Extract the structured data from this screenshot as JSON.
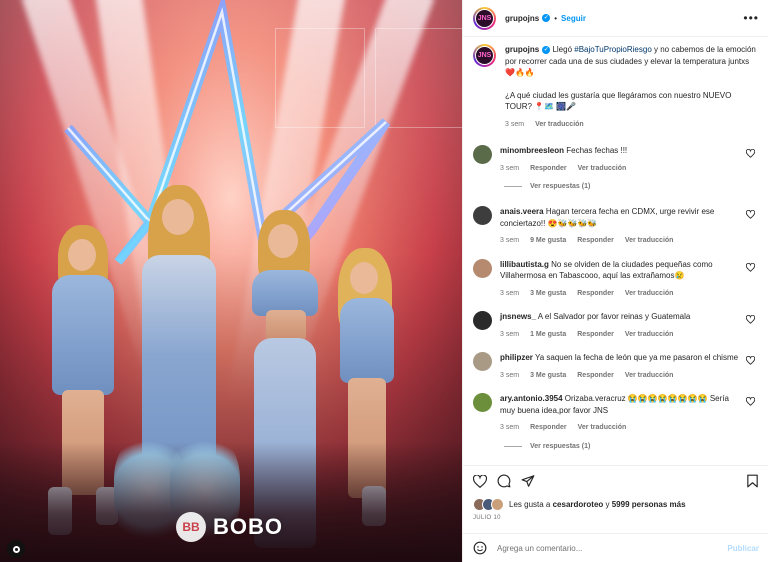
{
  "post": {
    "username": "grupojns",
    "follow_label": "Seguir",
    "separator": "•",
    "more_label": "•••",
    "avatar_text": "JNS"
  },
  "photo": {
    "watermark_text": "BOBO",
    "watermark_logo": "BB"
  },
  "caption": {
    "username": "grupojns",
    "text_before": " Llegó ",
    "hashtag": "#BajoTuPropioRiesgo",
    "text_after": " y no cabemos de la emoción por recorrer cada una de sus ciudades y elevar la temperatura juntxs❤️🔥🔥",
    "question": "¿A qué ciudad les gustaría que llegáramos con nuestro NUEVO TOUR? 📍🗺️ 🎆🎤",
    "time": "3 sem",
    "translation": "Ver traducción"
  },
  "comments": [
    {
      "username": "minombreesleon",
      "text": " Fechas fechas !!!",
      "time": "3 sem",
      "likes": "",
      "reply": "Responder",
      "translation": "Ver traducción",
      "replies": "Ver respuestas (1)",
      "avatar_color": "#5a6b4a"
    },
    {
      "username": "anais.veera",
      "text": " Hagan tercera fecha en CDMX, urge revivir ese conciertazo!! 😍🐝🐝🐝🐝",
      "time": "3 sem",
      "likes": "9 Me gusta",
      "reply": "Responder",
      "translation": "Ver traducción",
      "replies": "",
      "avatar_color": "#3d3d3d"
    },
    {
      "username": "lillibautista.g",
      "text": " No se olviden de la ciudades pequeñas como Villahermosa en Tabascooo, aquí las extrañamos😢",
      "time": "3 sem",
      "likes": "3 Me gusta",
      "reply": "Responder",
      "translation": "Ver traducción",
      "replies": "",
      "avatar_color": "#b58a6e"
    },
    {
      "username": "jnsnews_",
      "text": " A el Salvador por favor reinas y Guatemala",
      "time": "3 sem",
      "likes": "1 Me gusta",
      "reply": "Responder",
      "translation": "Ver traducción",
      "replies": "",
      "avatar_color": "#2a2a2a"
    },
    {
      "username": "philipzer",
      "text": " Ya saquen la fecha de león que ya me pasaron el chisme",
      "time": "3 sem",
      "likes": "3 Me gusta",
      "reply": "Responder",
      "translation": "Ver traducción",
      "replies": "",
      "avatar_color": "#a99a86"
    },
    {
      "username": "ary.antonio.3954",
      "text": " Orizaba.veracruz 😭😭😭😭😭😭😭😭 Sería muy buena idea,por favor JNS",
      "time": "3 sem",
      "likes": "",
      "reply": "Responder",
      "translation": "Ver traducción",
      "replies": "Ver respuestas (1)",
      "avatar_color": "#6b8f3a"
    }
  ],
  "actions": {
    "likes_prefix": "Les gusta a ",
    "likes_user": "cesardoroteo",
    "likes_middle": " y ",
    "likes_count": "5999 personas más",
    "date": "JULIO 10"
  },
  "add_comment": {
    "placeholder": "Agrega un comentario...",
    "publish": "Publicar"
  },
  "colors": {
    "accent": "#0095f6",
    "publish_disabled": "#b3dbff",
    "secondary_text": "#737373"
  },
  "icons": [
    "verified-icon",
    "more-icon",
    "heart-icon",
    "comment-icon",
    "share-icon",
    "save-icon",
    "emoji-icon"
  ]
}
